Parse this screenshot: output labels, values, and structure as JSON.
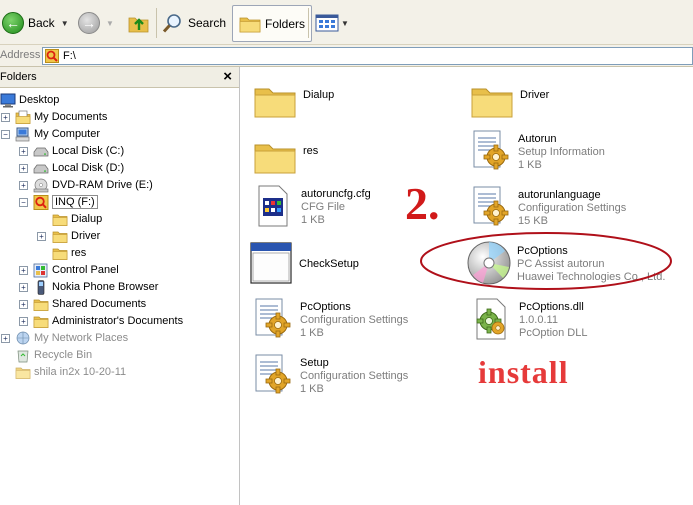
{
  "toolbar": {
    "back_label": "Back",
    "search_label": "Search",
    "folders_label": "Folders"
  },
  "address": {
    "label": "Address",
    "value": "F:\\"
  },
  "folders_pane": {
    "title": "Folders",
    "close_glyph": "×",
    "tree": [
      {
        "label": "Desktop"
      },
      {
        "label": "My Documents"
      },
      {
        "label": "My Computer"
      },
      {
        "label": "Local Disk (C:)"
      },
      {
        "label": "Local Disk  (D:)"
      },
      {
        "label": "DVD-RAM Drive (E:)"
      },
      {
        "label": "INQ (F:)"
      },
      {
        "label": "Dialup"
      },
      {
        "label": "Driver"
      },
      {
        "label": "res"
      },
      {
        "label": "Control Panel"
      },
      {
        "label": "Nokia Phone Browser"
      },
      {
        "label": "Shared Documents"
      },
      {
        "label": "Administrator's Documents"
      },
      {
        "label": "My Network Places"
      },
      {
        "label": "Recycle Bin"
      },
      {
        "label": "shila in2x 10-20-11"
      }
    ]
  },
  "files": [
    {
      "name": "Dialup",
      "line2": "",
      "line3": "",
      "icon": "folder-icon"
    },
    {
      "name": "Driver",
      "line2": "",
      "line3": "",
      "icon": "folder-icon"
    },
    {
      "name": "res",
      "line2": "",
      "line3": "",
      "icon": "folder-icon"
    },
    {
      "name": "Autorun",
      "line2": "Setup Information",
      "line3": "1 KB",
      "icon": "config-file-icon"
    },
    {
      "name": "autoruncfg.cfg",
      "line2": "CFG File",
      "line3": "1 KB",
      "icon": "cfg-file-icon"
    },
    {
      "name": "autorunlanguage",
      "line2": "Configuration Settings",
      "line3": "15 KB",
      "icon": "config-file-icon"
    },
    {
      "name": "CheckSetup",
      "line2": "",
      "line3": "",
      "icon": "application-window-icon"
    },
    {
      "name": "PcOptions",
      "line2": "PC Assist autorun",
      "line3": "Huawei Technologies Co., Ltd.",
      "icon": "cd-disc-icon"
    },
    {
      "name": "PcOptions",
      "line2": "Configuration Settings",
      "line3": "1 KB",
      "icon": "config-file-icon"
    },
    {
      "name": "PcOptions.dll",
      "line2": "1.0.0.11",
      "line3": "PcOption DLL",
      "icon": "dll-file-icon"
    },
    {
      "name": "Setup",
      "line2": "Configuration Settings",
      "line3": "1 KB",
      "icon": "config-file-icon"
    }
  ],
  "annotations": {
    "step": "2.",
    "install": "install"
  },
  "colors": {
    "annotation_red": "#d11a1a",
    "toolbar_bg": "#f3f1e8",
    "folder_yellow": "#f3d36b"
  }
}
